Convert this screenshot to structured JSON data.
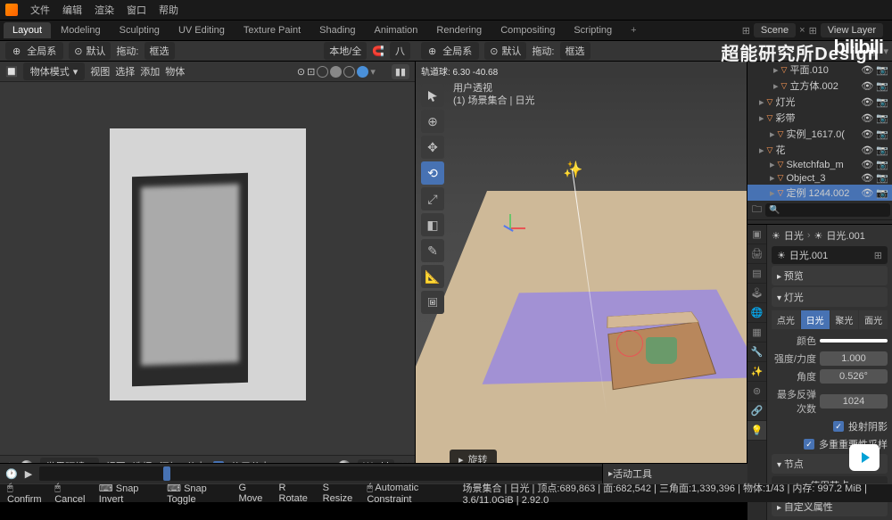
{
  "menu": {
    "file": "文件",
    "edit": "编辑",
    "render": "渲染",
    "window": "窗口",
    "help": "帮助"
  },
  "tabs": [
    "Layout",
    "Modeling",
    "Sculpting",
    "UV Editing",
    "Texture Paint",
    "Shading",
    "Animation",
    "Rendering",
    "Compositing",
    "Scripting"
  ],
  "scene": {
    "label": "Scene",
    "view_layer": "View Layer"
  },
  "header_left": {
    "global": "全局系",
    "orient": "默认",
    "drag": "拖动:",
    "select": "框选",
    "local": "本地/全",
    "snap": "八"
  },
  "left_toolbar": {
    "mode": "物体模式",
    "view": "视图",
    "select": "选择",
    "add": "添加",
    "object": "物体"
  },
  "right_viewport": {
    "header": {
      "global": "全局系",
      "orient": "默认",
      "drag": "拖动:",
      "select": "框选"
    },
    "range": "轨道球: 6.30 -40.68",
    "info_line1": "用户透视",
    "info_line2": "(1) 场景集合 | 日光",
    "rotate_label": "旋转"
  },
  "outliner": {
    "items": [
      {
        "name": "平面.010",
        "indent": 22,
        "tri": "▽"
      },
      {
        "name": "立方体.002",
        "indent": 22,
        "tri": "▽"
      },
      {
        "name": "灯光",
        "indent": 6,
        "tri": "▽",
        "light": true
      },
      {
        "name": "彩带",
        "indent": 6,
        "tri": "▽"
      },
      {
        "name": "实例_1617.0(",
        "indent": 18,
        "tri": "▽"
      },
      {
        "name": "花",
        "indent": 6,
        "tri": "▽"
      },
      {
        "name": "Sketchfab_m",
        "indent": 18,
        "tri": "▽"
      },
      {
        "name": "Object_3",
        "indent": 18,
        "tri": "▽"
      },
      {
        "name": "定例 1244.002",
        "indent": 18,
        "tri": "▽",
        "sel": true
      }
    ]
  },
  "props": {
    "sun_icon": "☀",
    "name1": "日光",
    "name2": "日光.001",
    "datablock": "日光.001",
    "preview": "预览",
    "light": "灯光",
    "types": [
      "点光",
      "日光",
      "聚光",
      "面光"
    ],
    "active_type": 1,
    "color": "颜色",
    "strength": "强度/力度",
    "strength_val": "1.000",
    "angle": "角度",
    "angle_val": "0.526°",
    "bounces": "最多反弹次数",
    "bounces_val": "1024",
    "shadow": "投射阴影",
    "mis": "多重重要性采样",
    "nodes": "节点",
    "use_nodes": "使用节点",
    "custom": "自定义属性"
  },
  "bottom_left": {
    "world_env": "世界环境",
    "view": "视图",
    "select": "选择",
    "add": "添加",
    "node": "节点",
    "use_nodes": "使用节点",
    "world": "World"
  },
  "timeline": {
    "active_tool": "活动工具"
  },
  "status": {
    "confirm": "Confirm",
    "cancel": "Cancel",
    "snap_invert": "Snap Invert",
    "snap_toggle": "Snap Toggle",
    "move": "Move",
    "rotate": "Rotate",
    "resize": "Resize",
    "auto": "Automatic Constraint",
    "stats": "场景集合 | 日光 | 顶点:689,863 | 面:682,542 | 三角面:1,339,396 | 物体:1/43 | 内存: 997.2 MiB | 3.6/11.0GiB | 2.92.0"
  },
  "watermark": "超能研究所Design"
}
